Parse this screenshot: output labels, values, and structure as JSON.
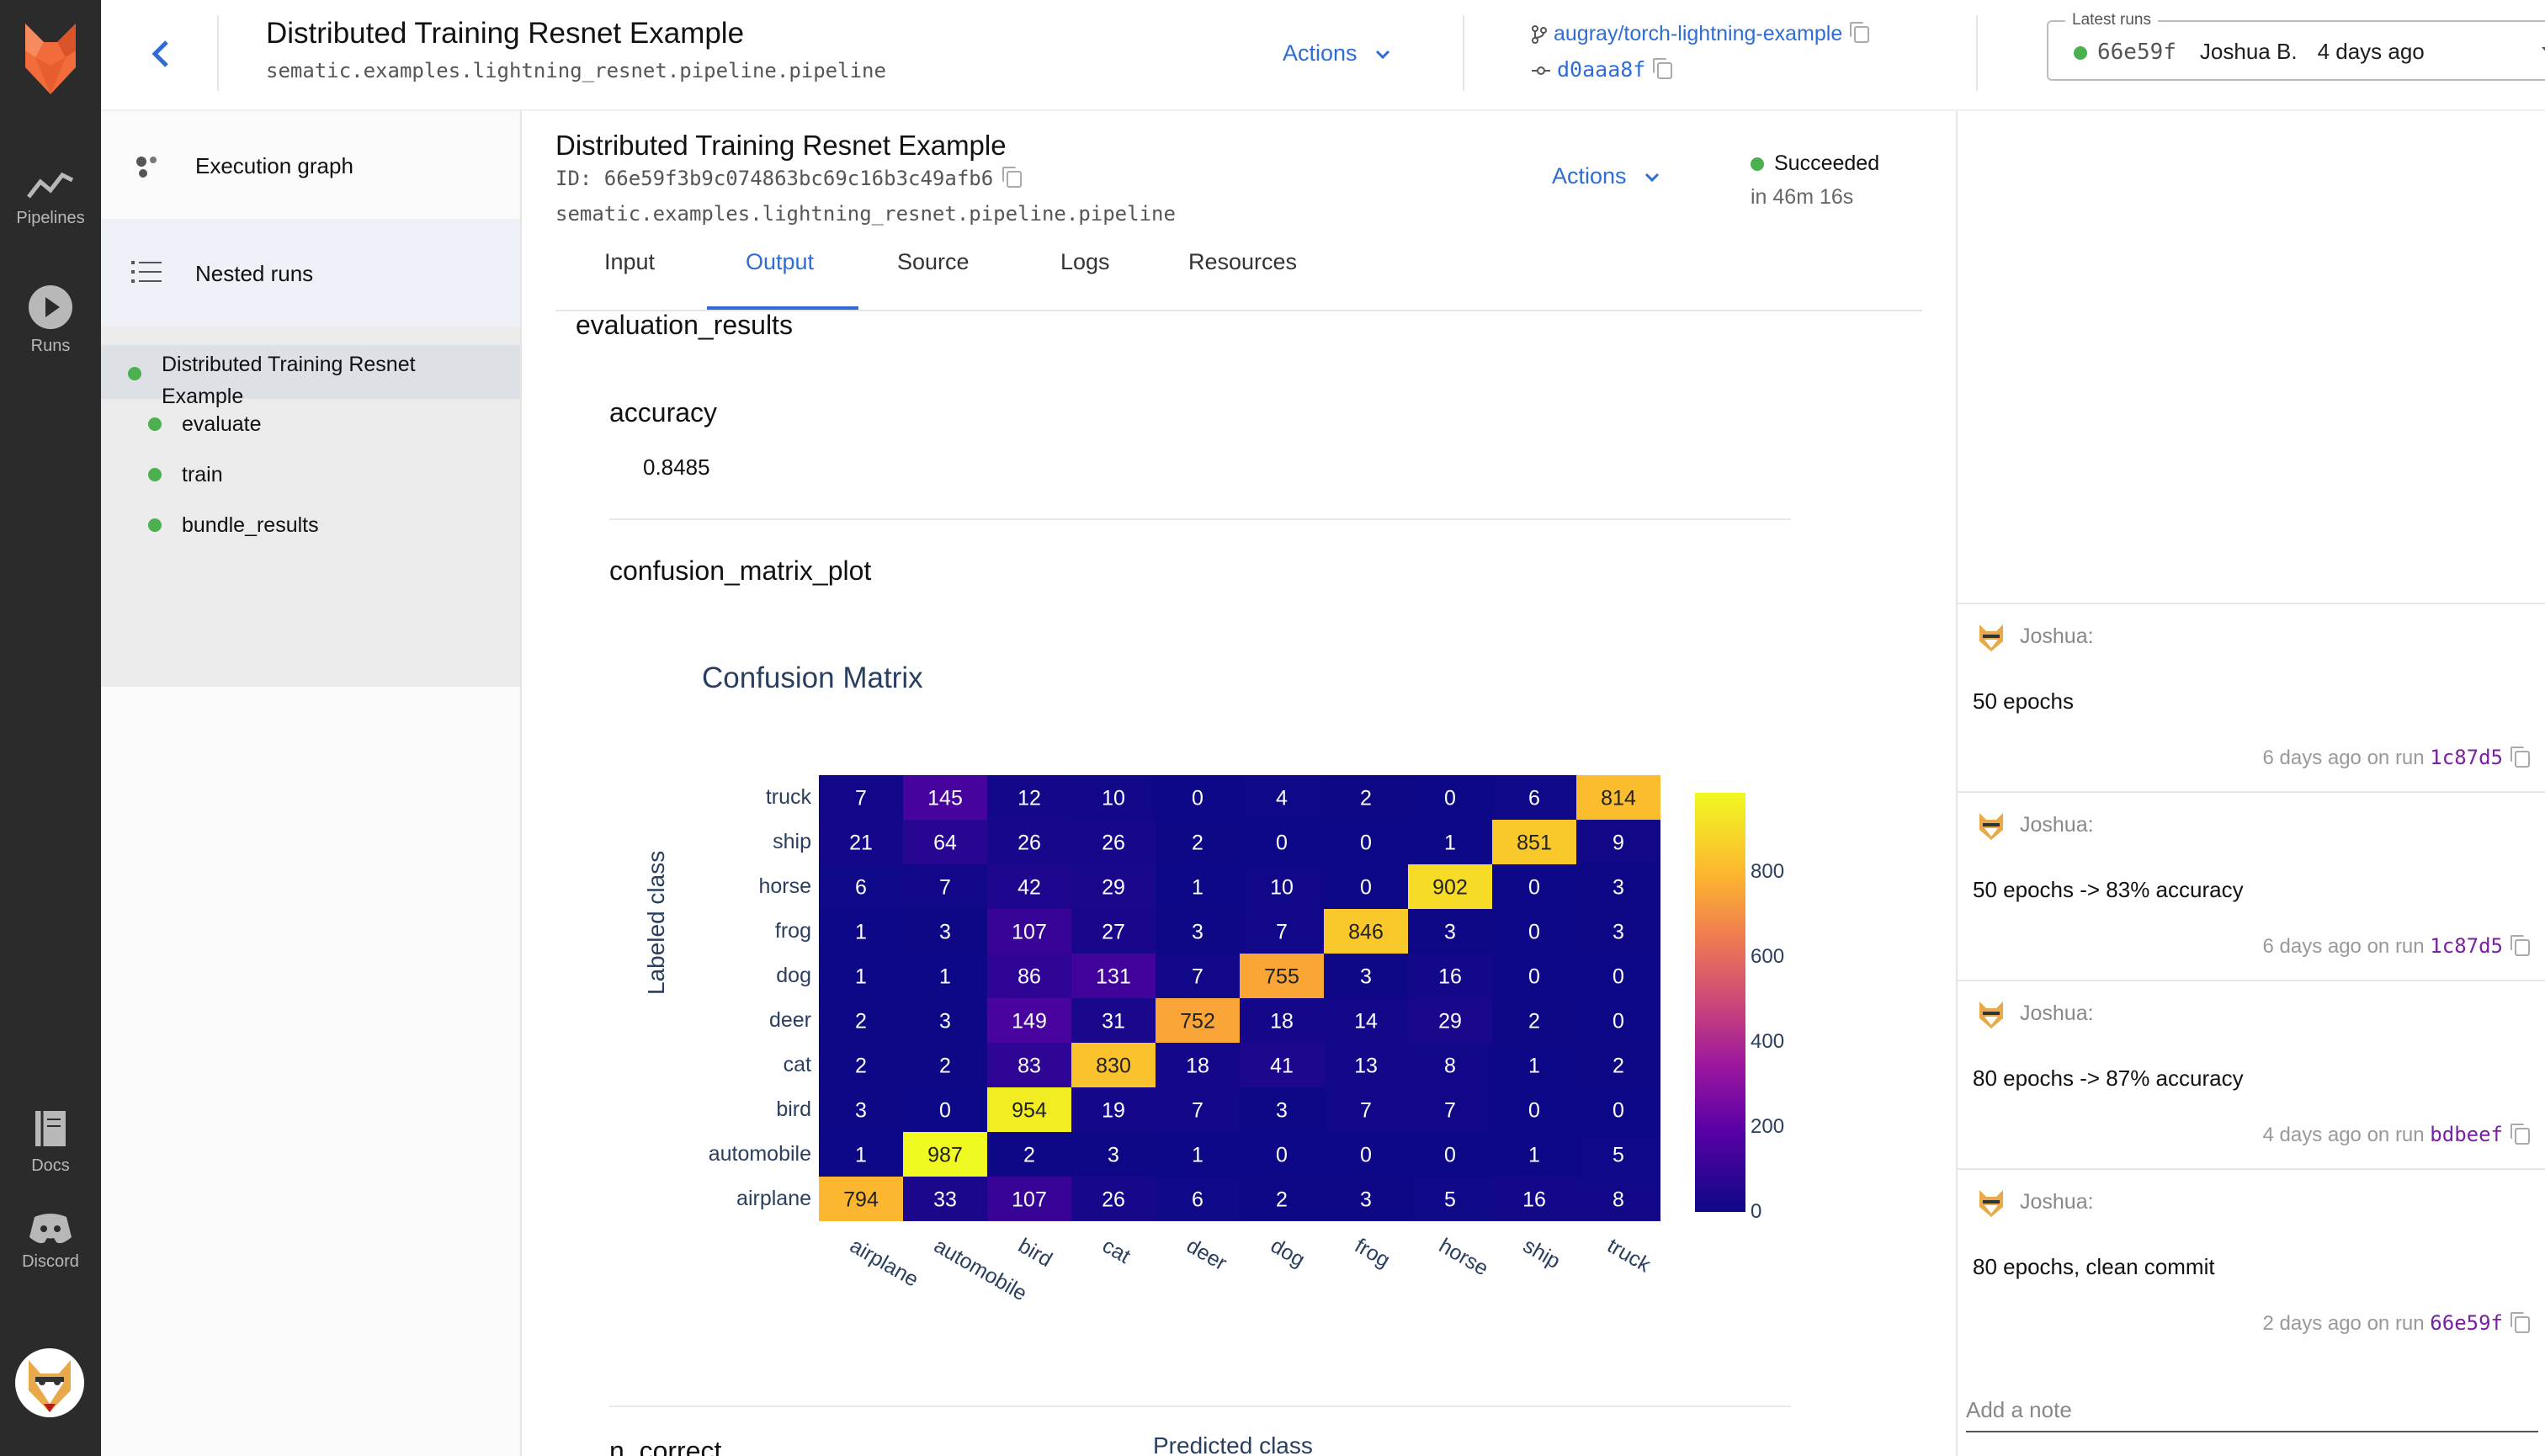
{
  "nav": {
    "pipelines": "Pipelines",
    "runs": "Runs",
    "docs": "Docs",
    "discord": "Discord"
  },
  "header": {
    "title": "Distributed Training Resnet Example",
    "subtitle": "sematic.examples.lightning_resnet.pipeline.pipeline",
    "actions": "Actions",
    "repo": "augray/torch-lightning-example",
    "commit": "d0aaa8f",
    "latest_runs_label": "Latest runs",
    "latest_run_id": "66e59f",
    "latest_run_user": "Joshua B.",
    "latest_run_time": "4 days ago"
  },
  "sidebar": {
    "execution_graph": "Execution graph",
    "nested_runs": "Nested runs",
    "tree": [
      {
        "label": "Distributed Training Resnet Example",
        "status_color": "#4caf50"
      },
      {
        "label": "evaluate",
        "status_color": "#4caf50"
      },
      {
        "label": "train",
        "status_color": "#4caf50"
      },
      {
        "label": "bundle_results",
        "status_color": "#4caf50"
      }
    ]
  },
  "run": {
    "title": "Distributed Training Resnet Example",
    "id": "ID: 66e59f3b9c074863bc69c16b3c49afb6",
    "path": "sematic.examples.lightning_resnet.pipeline.pipeline",
    "actions": "Actions",
    "status": "Succeeded",
    "duration": "in 46m 16s"
  },
  "tabs": [
    "Input",
    "Output",
    "Source",
    "Logs",
    "Resources"
  ],
  "active_tab": "Output",
  "output": {
    "section": "evaluation_results",
    "accuracy_label": "accuracy",
    "accuracy_value": "0.8485",
    "cm_label": "confusion_matrix_plot",
    "next_label": "n_correct"
  },
  "chart_data": {
    "type": "heatmap",
    "title": "Confusion Matrix",
    "xlabel": "Predicted class",
    "ylabel": "Labeled class",
    "x": [
      "airplane",
      "automobile",
      "bird",
      "cat",
      "deer",
      "dog",
      "frog",
      "horse",
      "ship",
      "truck"
    ],
    "y": [
      "truck",
      "ship",
      "horse",
      "frog",
      "dog",
      "deer",
      "cat",
      "bird",
      "automobile",
      "airplane"
    ],
    "z": [
      [
        7,
        145,
        12,
        10,
        0,
        4,
        2,
        0,
        6,
        814
      ],
      [
        21,
        64,
        26,
        26,
        2,
        0,
        0,
        1,
        851,
        9
      ],
      [
        6,
        7,
        42,
        29,
        1,
        10,
        0,
        902,
        0,
        3
      ],
      [
        1,
        3,
        107,
        27,
        3,
        7,
        846,
        3,
        0,
        3
      ],
      [
        1,
        1,
        86,
        131,
        7,
        755,
        3,
        16,
        0,
        0
      ],
      [
        2,
        3,
        149,
        31,
        752,
        18,
        14,
        29,
        2,
        0
      ],
      [
        2,
        2,
        83,
        830,
        18,
        41,
        13,
        8,
        1,
        2
      ],
      [
        3,
        0,
        954,
        19,
        7,
        3,
        7,
        7,
        0,
        0
      ],
      [
        1,
        987,
        2,
        3,
        1,
        0,
        0,
        0,
        1,
        5
      ],
      [
        794,
        33,
        107,
        26,
        6,
        2,
        3,
        5,
        16,
        8
      ]
    ],
    "colorscale": "plasma",
    "zrange": [
      0,
      987
    ],
    "colorbar_ticks": [
      "0",
      "200",
      "400",
      "600",
      "800"
    ]
  },
  "notes": [
    {
      "author": "Joshua:",
      "text": "50 epochs",
      "meta": "6 days ago on run ",
      "run": "1c87d5"
    },
    {
      "author": "Joshua:",
      "text": "50 epochs -> 83% accuracy",
      "meta": "6 days ago on run ",
      "run": "1c87d5"
    },
    {
      "author": "Joshua:",
      "text": "80 epochs -> 87% accuracy",
      "meta": "4 days ago on run ",
      "run": "bdbeef"
    },
    {
      "author": "Joshua:",
      "text": "80 epochs, clean commit",
      "meta": "2 days ago on run ",
      "run": "66e59f"
    }
  ],
  "add_note_placeholder": "Add a note",
  "colors": {
    "accent": "#2f6cd6",
    "success": "#4caf50",
    "nav_bg": "#2b2b2b",
    "brand": "#f26b3a"
  }
}
